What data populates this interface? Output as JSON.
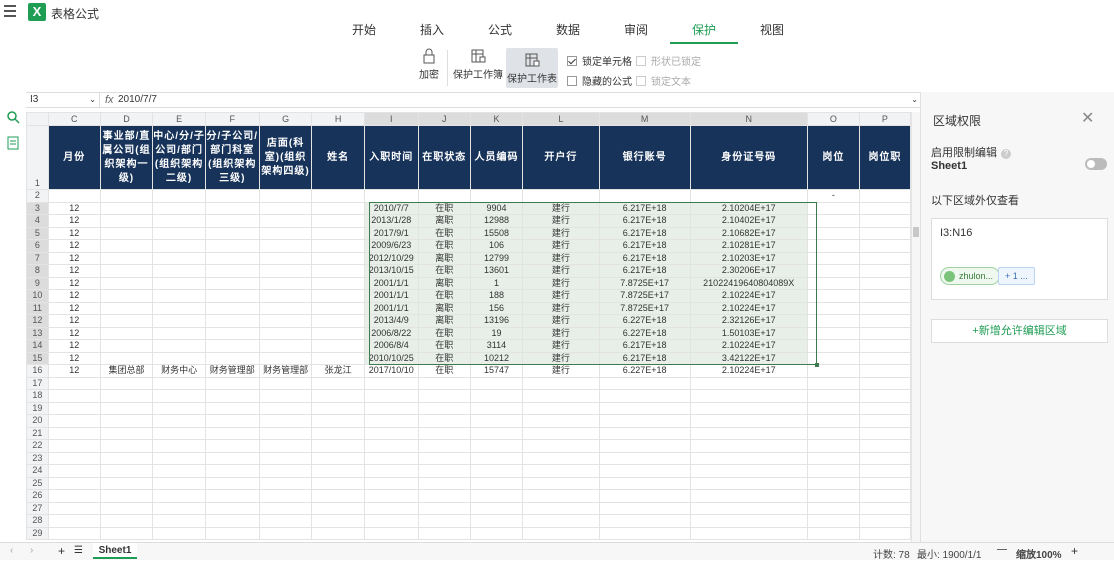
{
  "app": {
    "logo": "X",
    "title": "表格公式"
  },
  "tabs": [
    {
      "label": "开始",
      "active": false
    },
    {
      "label": "插入",
      "active": false
    },
    {
      "label": "公式",
      "active": false
    },
    {
      "label": "数据",
      "active": false
    },
    {
      "label": "审阅",
      "active": false
    },
    {
      "label": "保护",
      "active": true
    },
    {
      "label": "视图",
      "active": false
    }
  ],
  "ribbon": {
    "encrypt": "加密",
    "protect_workbook": "保护工作簿",
    "protect_sheet": "保护工作表",
    "lock_cell": "锁定单元格",
    "shape_locked": "形状已锁定",
    "hide_formula": "隐藏的公式",
    "lock_text": "锁定文本"
  },
  "formula_bar": {
    "cell_ref": "I3",
    "fx": "fx",
    "value": "2010/7/7"
  },
  "columns": [
    "C",
    "D",
    "E",
    "F",
    "G",
    "H",
    "I",
    "J",
    "K",
    "L",
    "M",
    "N",
    "O",
    "P"
  ],
  "selected_columns": [
    "I",
    "J",
    "K",
    "L",
    "M",
    "N"
  ],
  "header_row": [
    "月份",
    "事业部/直属公司(组织架构一级)",
    "中心/分/子公司/部门(组织架构二级)",
    "分/子公司/部门科室(组织架构三级)",
    "店面(科室)(组织架构四级)",
    "姓名",
    "入职时间",
    "在职状态",
    "人员编码",
    "开户行",
    "银行账号",
    "身份证号码",
    "岗位",
    "岗位职"
  ],
  "rows": [
    {
      "n": "2",
      "cells": [
        "",
        "",
        "",
        "",
        "",
        "",
        "",
        "",
        "",
        "",
        "",
        "",
        "-",
        ""
      ]
    },
    {
      "n": "3",
      "cells": [
        "12",
        "",
        "",
        "",
        "",
        "",
        "2010/7/7",
        "在职",
        "9904",
        "建行",
        "6.217E+18",
        "2.10204E+17",
        "",
        ""
      ]
    },
    {
      "n": "4",
      "cells": [
        "12",
        "",
        "",
        "",
        "",
        "",
        "2013/1/28",
        "离职",
        "12988",
        "建行",
        "6.217E+18",
        "2.10402E+17",
        "",
        ""
      ]
    },
    {
      "n": "5",
      "cells": [
        "12",
        "",
        "",
        "",
        "",
        "",
        "2017/9/1",
        "在职",
        "15508",
        "建行",
        "6.217E+18",
        "2.10682E+17",
        "",
        ""
      ]
    },
    {
      "n": "6",
      "cells": [
        "12",
        "",
        "",
        "",
        "",
        "",
        "2009/6/23",
        "在职",
        "106",
        "建行",
        "6.217E+18",
        "2.10281E+17",
        "",
        ""
      ]
    },
    {
      "n": "7",
      "cells": [
        "12",
        "",
        "",
        "",
        "",
        "",
        "2012/10/29",
        "离职",
        "12799",
        "建行",
        "6.217E+18",
        "2.10203E+17",
        "",
        ""
      ]
    },
    {
      "n": "8",
      "cells": [
        "12",
        "",
        "",
        "",
        "",
        "",
        "2013/10/15",
        "在职",
        "13601",
        "建行",
        "6.217E+18",
        "2.30206E+17",
        "",
        ""
      ]
    },
    {
      "n": "9",
      "cells": [
        "12",
        "",
        "",
        "",
        "",
        "",
        "2001/1/1",
        "离职",
        "1",
        "建行",
        "7.8725E+17",
        "210224196408040​89X",
        "",
        ""
      ]
    },
    {
      "n": "10",
      "cells": [
        "12",
        "",
        "",
        "",
        "",
        "",
        "2001/1/1",
        "在职",
        "188",
        "建行",
        "7.8725E+17",
        "2.10224E+17",
        "",
        ""
      ]
    },
    {
      "n": "11",
      "cells": [
        "12",
        "",
        "",
        "",
        "",
        "",
        "2001/1/1",
        "离职",
        "156",
        "建行",
        "7.8725E+17",
        "2.10224E+17",
        "",
        ""
      ]
    },
    {
      "n": "12",
      "cells": [
        "12",
        "",
        "",
        "",
        "",
        "",
        "2013/4/9",
        "离职",
        "13196",
        "建行",
        "6.227E+18",
        "2.32126E+17",
        "",
        ""
      ]
    },
    {
      "n": "13",
      "cells": [
        "12",
        "",
        "",
        "",
        "",
        "",
        "2006/8/22",
        "在职",
        "19",
        "建行",
        "6.227E+18",
        "1.50103E+17",
        "",
        ""
      ]
    },
    {
      "n": "14",
      "cells": [
        "12",
        "",
        "",
        "",
        "",
        "",
        "2006/8/4",
        "在职",
        "3114",
        "建行",
        "6.217E+18",
        "2.10224E+17",
        "",
        ""
      ]
    },
    {
      "n": "15",
      "cells": [
        "12",
        "",
        "",
        "",
        "",
        "",
        "2010/10/25",
        "在职",
        "10212",
        "建行",
        "6.217E+18",
        "3.42122E+17",
        "",
        ""
      ]
    },
    {
      "n": "16",
      "cells": [
        "12",
        "集团总部",
        "财务中心",
        "财务管理部",
        "财务管理部",
        "张龙江",
        "2017/10/10",
        "在职",
        "15747",
        "建行",
        "6.227E+18",
        "2.10224E+17",
        "",
        ""
      ]
    },
    {
      "n": "17",
      "cells": [
        "",
        "",
        "",
        "",
        "",
        "",
        "",
        "",
        "",
        "",
        "",
        "",
        "",
        ""
      ]
    },
    {
      "n": "18",
      "cells": [
        "",
        "",
        "",
        "",
        "",
        "",
        "",
        "",
        "",
        "",
        "",
        "",
        "",
        ""
      ]
    },
    {
      "n": "19",
      "cells": [
        "",
        "",
        "",
        "",
        "",
        "",
        "",
        "",
        "",
        "",
        "",
        "",
        "",
        ""
      ]
    },
    {
      "n": "20",
      "cells": [
        "",
        "",
        "",
        "",
        "",
        "",
        "",
        "",
        "",
        "",
        "",
        "",
        "",
        ""
      ]
    },
    {
      "n": "21",
      "cells": [
        "",
        "",
        "",
        "",
        "",
        "",
        "",
        "",
        "",
        "",
        "",
        "",
        "",
        ""
      ]
    },
    {
      "n": "22",
      "cells": [
        "",
        "",
        "",
        "",
        "",
        "",
        "",
        "",
        "",
        "",
        "",
        "",
        "",
        ""
      ]
    },
    {
      "n": "23",
      "cells": [
        "",
        "",
        "",
        "",
        "",
        "",
        "",
        "",
        "",
        "",
        "",
        "",
        "",
        ""
      ]
    },
    {
      "n": "24",
      "cells": [
        "",
        "",
        "",
        "",
        "",
        "",
        "",
        "",
        "",
        "",
        "",
        "",
        "",
        ""
      ]
    },
    {
      "n": "25",
      "cells": [
        "",
        "",
        "",
        "",
        "",
        "",
        "",
        "",
        "",
        "",
        "",
        "",
        "",
        ""
      ]
    },
    {
      "n": "26",
      "cells": [
        "",
        "",
        "",
        "",
        "",
        "",
        "",
        "",
        "",
        "",
        "",
        "",
        "",
        ""
      ]
    },
    {
      "n": "27",
      "cells": [
        "",
        "",
        "",
        "",
        "",
        "",
        "",
        "",
        "",
        "",
        "",
        "",
        "",
        ""
      ]
    },
    {
      "n": "28",
      "cells": [
        "",
        "",
        "",
        "",
        "",
        "",
        "",
        "",
        "",
        "",
        "",
        "",
        "",
        ""
      ]
    },
    {
      "n": "29",
      "cells": [
        "",
        "",
        "",
        "",
        "",
        "",
        "",
        "",
        "",
        "",
        "",
        "",
        "",
        ""
      ]
    }
  ],
  "panel": {
    "title": "区域权限",
    "enable_label": "启用限制编辑",
    "help": "?",
    "sheet_name": "Sheet1",
    "outside_label": "以下区域外仅查看",
    "range": "I3:N16",
    "user_chip": "zhulon...",
    "more_chip": "+ 1 ...",
    "add_button": "+新增允许编辑区域"
  },
  "sheetbar": {
    "sheet_tab": "Sheet1",
    "count": "计数: 78",
    "min": "最小: 1900/1/1",
    "zoom": "缩放100%",
    "plus": "+",
    "add": "+"
  }
}
